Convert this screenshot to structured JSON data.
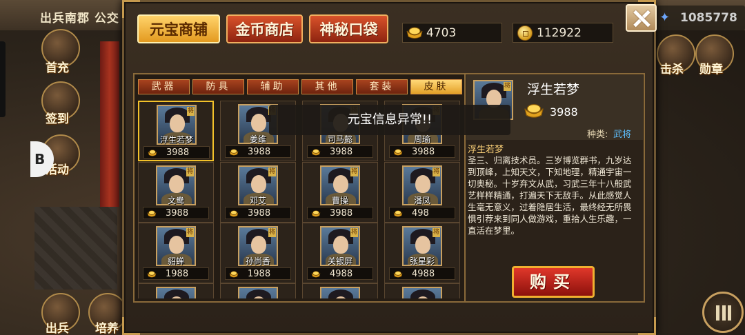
{
  "background": {
    "title": "出兵南郡 公交",
    "power_value": "1085778",
    "side_buttons": {
      "first_recharge": "首充",
      "sign_in": "签到",
      "event": "活动",
      "deploy": "出兵",
      "train": "培养",
      "kill": "击杀",
      "medal": "勋章"
    },
    "fab_label": "B"
  },
  "shop": {
    "tabs": [
      {
        "label": "元宝商铺",
        "active": true
      },
      {
        "label": "金币商店",
        "active": false
      },
      {
        "label": "神秘口袋",
        "active": false
      }
    ],
    "yuanbao_balance": "4703",
    "coin_balance": "112922",
    "subtabs": [
      {
        "label": "武器",
        "active": false
      },
      {
        "label": "防具",
        "active": false
      },
      {
        "label": "辅助",
        "active": false
      },
      {
        "label": "其他",
        "active": false
      },
      {
        "label": "套装",
        "active": false
      },
      {
        "label": "皮肤",
        "active": true
      }
    ],
    "items": [
      {
        "name": "浮生若梦",
        "price": "3988",
        "selected": true
      },
      {
        "name": "姜维",
        "price": "3988",
        "selected": false
      },
      {
        "name": "司马懿",
        "price": "3988",
        "selected": false
      },
      {
        "name": "周瑜",
        "price": "3988",
        "selected": false
      },
      {
        "name": "文鸯",
        "price": "3988",
        "selected": false
      },
      {
        "name": "邓艾",
        "price": "3988",
        "selected": false
      },
      {
        "name": "曹操",
        "price": "3988",
        "selected": false
      },
      {
        "name": "潘凤",
        "price": "498",
        "selected": false
      },
      {
        "name": "貂蝉",
        "price": "1988",
        "selected": false
      },
      {
        "name": "孙尚香",
        "price": "1988",
        "selected": false
      },
      {
        "name": "关银屏",
        "price": "4988",
        "selected": false
      },
      {
        "name": "张星彩",
        "price": "4988",
        "selected": false
      }
    ],
    "badge_text": "将",
    "detail": {
      "name": "浮生若梦",
      "price": "3988",
      "type_label": "种类:",
      "type_value": "武将",
      "title": "浮生若梦",
      "description": "圣三、归离技术员。三岁博览群书，九岁达到顶峰，上知天文，下知地理，精通宇宙一切奥秘。十岁弃文从武，习武三年十八般武艺样样精通，打遍天下无敌手。从此感觉人生毫无意义，过着隐居生活，最终经无所畏惧引荐来到同人做游戏，重拾人生乐趣，一直活在梦里。",
      "buy_label": "购买"
    },
    "toast": "元宝信息异常!!"
  },
  "colors": {
    "accent_gold": "#f3c22a",
    "tab_red": "#d9522a",
    "type_blue": "#5ec0ff",
    "buy_red": "#e0372a"
  }
}
